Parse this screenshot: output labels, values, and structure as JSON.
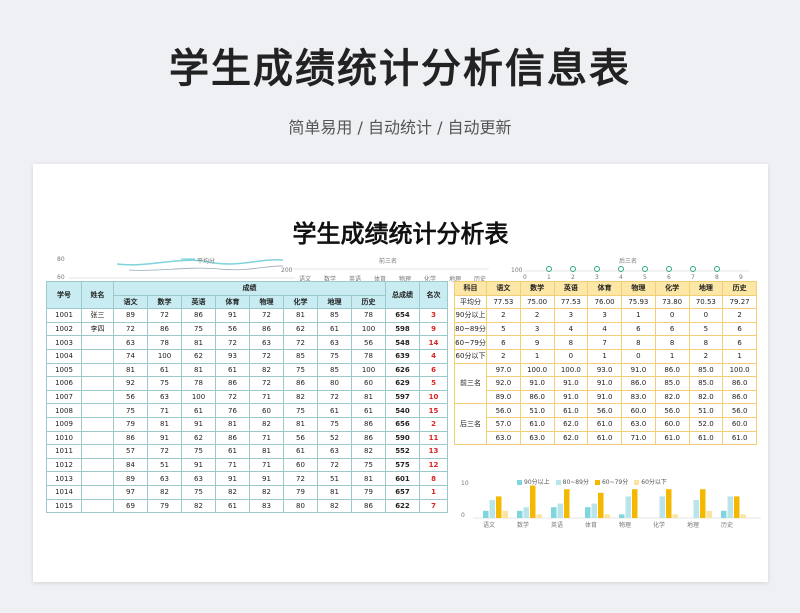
{
  "hero": {
    "title": "学生成绩统计分析信息表",
    "subtitle": "简单易用 / 自动统计 / 自动更新"
  },
  "sheet": {
    "title": "学生成绩统计分析表"
  },
  "avg_chart": {
    "label": "平均分",
    "y_ticks": [
      "80",
      "60"
    ],
    "color": "#7fd3da"
  },
  "top3_chart": {
    "label": "前三名",
    "y_tick": "200",
    "x_labels": [
      "语文",
      "数学",
      "英语",
      "体育",
      "物理",
      "化学",
      "地理",
      "历史"
    ]
  },
  "bottom3_chart": {
    "label": "后三名",
    "y_tick": "100",
    "x_ticks": [
      "0",
      "1",
      "2",
      "3",
      "4",
      "5",
      "6",
      "7",
      "8",
      "9"
    ],
    "marker_color": "#2ea77d"
  },
  "main_table": {
    "headers": {
      "id": "学号",
      "name": "姓名",
      "scores_group": "成绩",
      "subjects": [
        "语文",
        "数学",
        "英语",
        "体育",
        "物理",
        "化学",
        "地理",
        "历史"
      ],
      "total": "总成绩",
      "rank": "名次"
    },
    "rows": [
      {
        "id": "1001",
        "name": "张三",
        "scores": [
          "89",
          "72",
          "86",
          "91",
          "72",
          "81",
          "85",
          "78"
        ],
        "total": "654",
        "rank": "3"
      },
      {
        "id": "1002",
        "name": "李四",
        "scores": [
          "72",
          "86",
          "75",
          "56",
          "86",
          "62",
          "61",
          "100"
        ],
        "total": "598",
        "rank": "9"
      },
      {
        "id": "1003",
        "name": "",
        "scores": [
          "63",
          "78",
          "81",
          "72",
          "63",
          "72",
          "63",
          "56"
        ],
        "total": "548",
        "rank": "14"
      },
      {
        "id": "1004",
        "name": "",
        "scores": [
          "74",
          "100",
          "62",
          "93",
          "72",
          "85",
          "75",
          "78"
        ],
        "total": "639",
        "rank": "4"
      },
      {
        "id": "1005",
        "name": "",
        "scores": [
          "81",
          "61",
          "81",
          "61",
          "82",
          "75",
          "85",
          "100"
        ],
        "total": "626",
        "rank": "6"
      },
      {
        "id": "1006",
        "name": "",
        "scores": [
          "92",
          "75",
          "78",
          "86",
          "72",
          "86",
          "80",
          "60"
        ],
        "total": "629",
        "rank": "5"
      },
      {
        "id": "1007",
        "name": "",
        "scores": [
          "56",
          "63",
          "100",
          "72",
          "71",
          "82",
          "72",
          "81"
        ],
        "total": "597",
        "rank": "10"
      },
      {
        "id": "1008",
        "name": "",
        "scores": [
          "75",
          "71",
          "61",
          "76",
          "60",
          "75",
          "61",
          "61"
        ],
        "total": "540",
        "rank": "15"
      },
      {
        "id": "1009",
        "name": "",
        "scores": [
          "79",
          "81",
          "91",
          "81",
          "82",
          "81",
          "75",
          "86"
        ],
        "total": "656",
        "rank": "2"
      },
      {
        "id": "1010",
        "name": "",
        "scores": [
          "86",
          "91",
          "62",
          "86",
          "71",
          "56",
          "52",
          "86"
        ],
        "total": "590",
        "rank": "11"
      },
      {
        "id": "1011",
        "name": "",
        "scores": [
          "57",
          "72",
          "75",
          "61",
          "81",
          "61",
          "63",
          "82"
        ],
        "total": "552",
        "rank": "13"
      },
      {
        "id": "1012",
        "name": "",
        "scores": [
          "84",
          "51",
          "91",
          "71",
          "71",
          "60",
          "72",
          "75"
        ],
        "total": "575",
        "rank": "12"
      },
      {
        "id": "1013",
        "name": "",
        "scores": [
          "89",
          "63",
          "63",
          "91",
          "91",
          "72",
          "51",
          "81"
        ],
        "total": "601",
        "rank": "8"
      },
      {
        "id": "1014",
        "name": "",
        "scores": [
          "97",
          "82",
          "75",
          "82",
          "82",
          "79",
          "81",
          "79"
        ],
        "total": "657",
        "rank": "1"
      },
      {
        "id": "1015",
        "name": "",
        "scores": [
          "69",
          "79",
          "82",
          "61",
          "83",
          "80",
          "82",
          "86"
        ],
        "total": "622",
        "rank": "7"
      }
    ]
  },
  "stats_table": {
    "headers": [
      "科目",
      "语文",
      "数学",
      "英语",
      "体育",
      "物理",
      "化学",
      "地理",
      "历史"
    ],
    "rows": [
      {
        "label": "平均分",
        "values": [
          "77.53",
          "75.00",
          "77.53",
          "76.00",
          "75.93",
          "73.80",
          "70.53",
          "79.27"
        ]
      },
      {
        "label": "90分以上",
        "values": [
          "2",
          "2",
          "3",
          "3",
          "1",
          "0",
          "0",
          "2"
        ]
      },
      {
        "label": "80~89分",
        "values": [
          "5",
          "3",
          "4",
          "4",
          "6",
          "6",
          "5",
          "6"
        ]
      },
      {
        "label": "60~79分",
        "values": [
          "6",
          "9",
          "8",
          "7",
          "8",
          "8",
          "8",
          "6"
        ]
      },
      {
        "label": "60分以下",
        "values": [
          "2",
          "1",
          "0",
          "1",
          "0",
          "1",
          "2",
          "1"
        ]
      }
    ],
    "top3_label": "前三名",
    "top3": [
      [
        "97.0",
        "100.0",
        "100.0",
        "93.0",
        "91.0",
        "86.0",
        "85.0",
        "100.0"
      ],
      [
        "92.0",
        "91.0",
        "91.0",
        "91.0",
        "86.0",
        "85.0",
        "85.0",
        "86.0"
      ],
      [
        "89.0",
        "86.0",
        "91.0",
        "91.0",
        "83.0",
        "82.0",
        "82.0",
        "86.0"
      ]
    ],
    "bottom3_label": "后三名",
    "bottom3": [
      [
        "56.0",
        "51.0",
        "61.0",
        "56.0",
        "60.0",
        "56.0",
        "51.0",
        "56.0"
      ],
      [
        "57.0",
        "61.0",
        "62.0",
        "61.0",
        "63.0",
        "60.0",
        "52.0",
        "60.0"
      ],
      [
        "63.0",
        "63.0",
        "62.0",
        "61.0",
        "71.0",
        "61.0",
        "61.0",
        "61.0"
      ]
    ]
  },
  "chart_data": {
    "type": "bar",
    "categories": [
      "语文",
      "数学",
      "英语",
      "体育",
      "物理",
      "化学",
      "地理",
      "历史"
    ],
    "series": [
      {
        "name": "90分以上",
        "values": [
          2,
          2,
          3,
          3,
          1,
          0,
          0,
          2
        ],
        "color": "#7fd6de"
      },
      {
        "name": "80~89分",
        "values": [
          5,
          3,
          4,
          4,
          6,
          6,
          5,
          6
        ],
        "color": "#b9e4ea"
      },
      {
        "name": "60~79分",
        "values": [
          6,
          9,
          8,
          7,
          8,
          8,
          8,
          6
        ],
        "color": "#f5b800"
      },
      {
        "name": "60分以下",
        "values": [
          2,
          1,
          0,
          1,
          0,
          1,
          2,
          1
        ],
        "color": "#fbe3a0"
      }
    ],
    "y_ticks": [
      "10",
      "0"
    ],
    "ylim": [
      0,
      10
    ],
    "legend_position": "top"
  }
}
